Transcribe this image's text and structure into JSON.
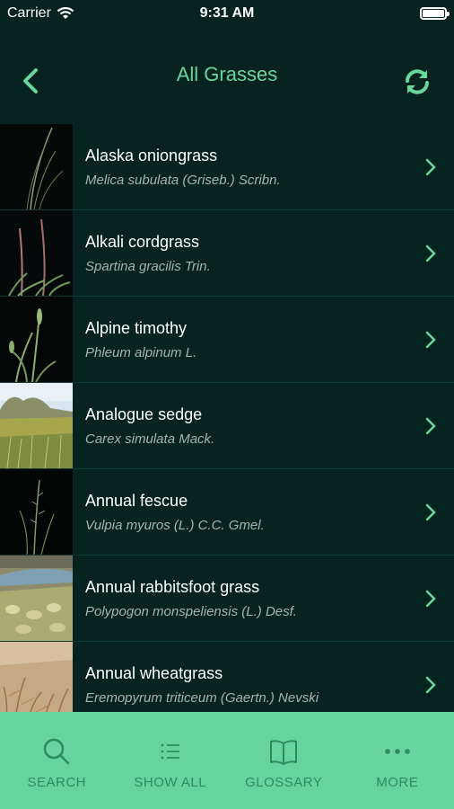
{
  "status_bar": {
    "carrier": "Carrier",
    "time": "9:31 AM",
    "battery_level": 1.0
  },
  "nav": {
    "title": "All Grasses",
    "back_icon": "chevron-left-icon",
    "refresh_icon": "refresh-icon"
  },
  "grasses": [
    {
      "name": "Alaska oniongrass",
      "scientific": "Melica subulata (Griseb.) Scribn."
    },
    {
      "name": "Alkali cordgrass",
      "scientific": "Spartina gracilis Trin."
    },
    {
      "name": "Alpine timothy",
      "scientific": "Phleum alpinum L."
    },
    {
      "name": "Analogue sedge",
      "scientific": "Carex simulata Mack."
    },
    {
      "name": "Annual fescue",
      "scientific": "Vulpia myuros (L.) C.C. Gmel."
    },
    {
      "name": "Annual rabbitsfoot grass",
      "scientific": "Polypogon monspeliensis (L.) Desf."
    },
    {
      "name": "Annual wheatgrass",
      "scientific": "Eremopyrum triticeum (Gaertn.) Nevski"
    }
  ],
  "tabs": [
    {
      "label": "SEARCH",
      "icon": "search-icon"
    },
    {
      "label": "SHOW ALL",
      "icon": "list-icon"
    },
    {
      "label": "GLOSSARY",
      "icon": "book-icon"
    },
    {
      "label": "MORE",
      "icon": "more-icon"
    }
  ],
  "colors": {
    "background": "#06231f",
    "accent": "#69d69c",
    "tab_bar": "#66d49c",
    "tab_text": "#2f8a62"
  }
}
